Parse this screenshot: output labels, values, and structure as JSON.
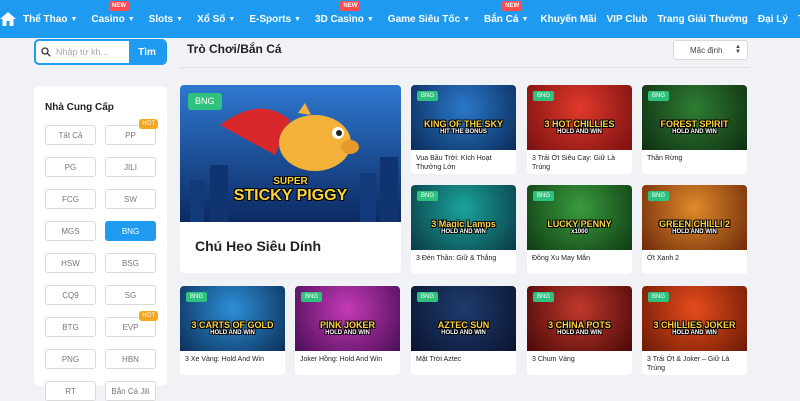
{
  "nav": {
    "items": [
      {
        "label": "Thể Thao",
        "chevron": true,
        "new": ""
      },
      {
        "label": "Casino",
        "chevron": true,
        "new": "NEW"
      },
      {
        "label": "Slots",
        "chevron": true,
        "new": ""
      },
      {
        "label": "Xổ Số",
        "chevron": true,
        "new": ""
      },
      {
        "label": "E-Sports",
        "chevron": true,
        "new": ""
      },
      {
        "label": "3D Casino",
        "chevron": true,
        "new": "NEW"
      },
      {
        "label": "Game Siêu Tốc",
        "chevron": true,
        "new": ""
      },
      {
        "label": "Bắn Cá",
        "chevron": true,
        "new": "NEW"
      }
    ],
    "right": [
      "Khuyến Mãi",
      "VIP Club",
      "Trang Giải Thưởng",
      "Đại Lý",
      "Thêm"
    ]
  },
  "search": {
    "placeholder": "Nhập từ kh...",
    "button": "Tìm"
  },
  "sidebar": {
    "title": "Nhà Cung Cấp",
    "providers": [
      {
        "label": "Tất Cả",
        "hot": "",
        "active": false
      },
      {
        "label": "PP",
        "hot": "HOT",
        "active": false
      },
      {
        "label": "PG",
        "hot": "",
        "active": false
      },
      {
        "label": "JILI",
        "hot": "",
        "active": false
      },
      {
        "label": "FCG",
        "hot": "",
        "active": false
      },
      {
        "label": "SW",
        "hot": "",
        "active": false
      },
      {
        "label": "MGS",
        "hot": "",
        "active": false
      },
      {
        "label": "BNG",
        "hot": "",
        "active": true
      },
      {
        "label": "HSW",
        "hot": "",
        "active": false
      },
      {
        "label": "BSG",
        "hot": "",
        "active": false
      },
      {
        "label": "CQ9",
        "hot": "",
        "active": false
      },
      {
        "label": "SG",
        "hot": "",
        "active": false
      },
      {
        "label": "BTG",
        "hot": "",
        "active": false
      },
      {
        "label": "EVP",
        "hot": "HOT",
        "active": false
      },
      {
        "label": "PNG",
        "hot": "",
        "active": false
      },
      {
        "label": "HBN",
        "hot": "",
        "active": false
      },
      {
        "label": "RT",
        "hot": "",
        "active": false
      },
      {
        "label": "Bắn Cá Jili",
        "hot": "",
        "active": false
      }
    ]
  },
  "main": {
    "title": "Trò Chơi/Bắn Cá",
    "sort_label": "Mặc định",
    "featured": {
      "badge": "BNG",
      "name": "Chú Heo Siêu Dính",
      "logo": [
        "SUPER",
        "STICKY PIGGY"
      ],
      "colors": [
        "#1c5fb8",
        "#0d2f6e"
      ]
    },
    "games": [
      {
        "badge": "BNG",
        "name": "Vua Bầu Trời: Kích Hoạt Thưởng Lớn",
        "logo": [
          "KING OF THE SKY",
          "HIT THE BONUS"
        ],
        "colors": [
          "#2a79c9",
          "#0b2a5a"
        ]
      },
      {
        "badge": "BNG",
        "name": "3 Trái Ớt Siêu Cay: Giữ Là Trúng",
        "logo": [
          "3 HOT CHILLIES",
          "HOLD AND WIN"
        ],
        "colors": [
          "#e0392b",
          "#7a1010"
        ]
      },
      {
        "badge": "BNG",
        "name": "Thần Rừng",
        "logo": [
          "FOREST SPIRIT",
          "HOLD AND WIN"
        ],
        "colors": [
          "#2e7d32",
          "#0f2e12"
        ]
      },
      {
        "badge": "BNG",
        "name": "3 Đèn Thần: Giữ & Thắng",
        "logo": [
          "3 Magic Lamps",
          "HOLD AND WIN"
        ],
        "colors": [
          "#1aa39a",
          "#0a3a45"
        ]
      },
      {
        "badge": "BNG",
        "name": "Đồng Xu May Mắn",
        "logo": [
          "LUCKY PENNY",
          "x1000"
        ],
        "colors": [
          "#3a9b3d",
          "#0f3b14"
        ]
      },
      {
        "badge": "BNG",
        "name": "Ớt Xanh 2",
        "logo": [
          "GREEN CHILLI 2",
          "HOLD AND WIN"
        ],
        "colors": [
          "#e08a2b",
          "#6e2a0a"
        ]
      },
      {
        "badge": "BNG",
        "name": "3 Xe Vàng: Hold And Win",
        "logo": [
          "3 CARTS OF GOLD",
          "HOLD AND WIN"
        ],
        "colors": [
          "#2d8fd6",
          "#0c2f59"
        ]
      },
      {
        "badge": "BNG",
        "name": "Joker Hồng: Hold And Win",
        "logo": [
          "PINK JOKER",
          "HOLD AND WIN"
        ],
        "colors": [
          "#c43ab5",
          "#4a0e57"
        ]
      },
      {
        "badge": "BNG",
        "name": "Mặt Trời Aztec",
        "logo": [
          "AZTEC SUN",
          "HOLD AND WIN"
        ],
        "colors": [
          "#1f3c6e",
          "#0a1430"
        ]
      },
      {
        "badge": "BNG",
        "name": "3 Chum Vàng",
        "logo": [
          "3 CHINA POTS",
          "HOLD AND WIN"
        ],
        "colors": [
          "#c0392b",
          "#4a0808"
        ]
      },
      {
        "badge": "BNG",
        "name": "3 Trái Ớt & Joker – Giữ Là Trúng",
        "logo": [
          "3 CHILLIES JOKER",
          "HOLD AND WIN"
        ],
        "colors": [
          "#e74c1c",
          "#6b1a05"
        ]
      }
    ]
  }
}
